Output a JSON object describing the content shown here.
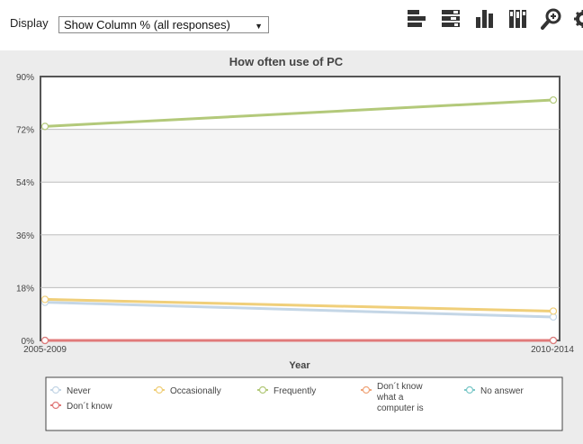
{
  "toolbar": {
    "display_label": "Display",
    "select_value": "Show Column % (all responses)",
    "icons": [
      "horizontal-bar-chart-icon",
      "stacked-horizontal-bar-icon",
      "vertical-bar-chart-icon",
      "stacked-vertical-bar-icon",
      "zoom-icon",
      "settings-gear-icon"
    ]
  },
  "colors": {
    "Never": "#c4d6e6",
    "Occasionally": "#f0cf7a",
    "Frequently": "#b3c97a",
    "Don´t know what a computer is": "#f0a57a",
    "No answer": "#7cc8c8",
    "Don´t know": "#e07a7a"
  },
  "chart_data": {
    "type": "line",
    "title": "How often use of PC",
    "xlabel": "Year",
    "ylabel": "",
    "categories": [
      "2005-2009",
      "2010-2014"
    ],
    "ylim": [
      0,
      90
    ],
    "yticks": [
      "0%",
      "18%",
      "36%",
      "54%",
      "72%",
      "90%"
    ],
    "series": [
      {
        "name": "Never",
        "values": [
          13,
          8
        ]
      },
      {
        "name": "Occasionally",
        "values": [
          14,
          10
        ]
      },
      {
        "name": "Frequently",
        "values": [
          73,
          82
        ]
      },
      {
        "name": "Don´t know what a computer is",
        "values": [
          0,
          0
        ]
      },
      {
        "name": "No answer",
        "values": [
          0,
          0
        ]
      },
      {
        "name": "Don´t know",
        "values": [
          0,
          0
        ]
      }
    ],
    "legend": [
      "Never",
      "Occasionally",
      "Frequently",
      "Don´t know what a computer is",
      "No answer",
      "Don´t know"
    ],
    "grid": true,
    "legend_position": "bottom"
  }
}
